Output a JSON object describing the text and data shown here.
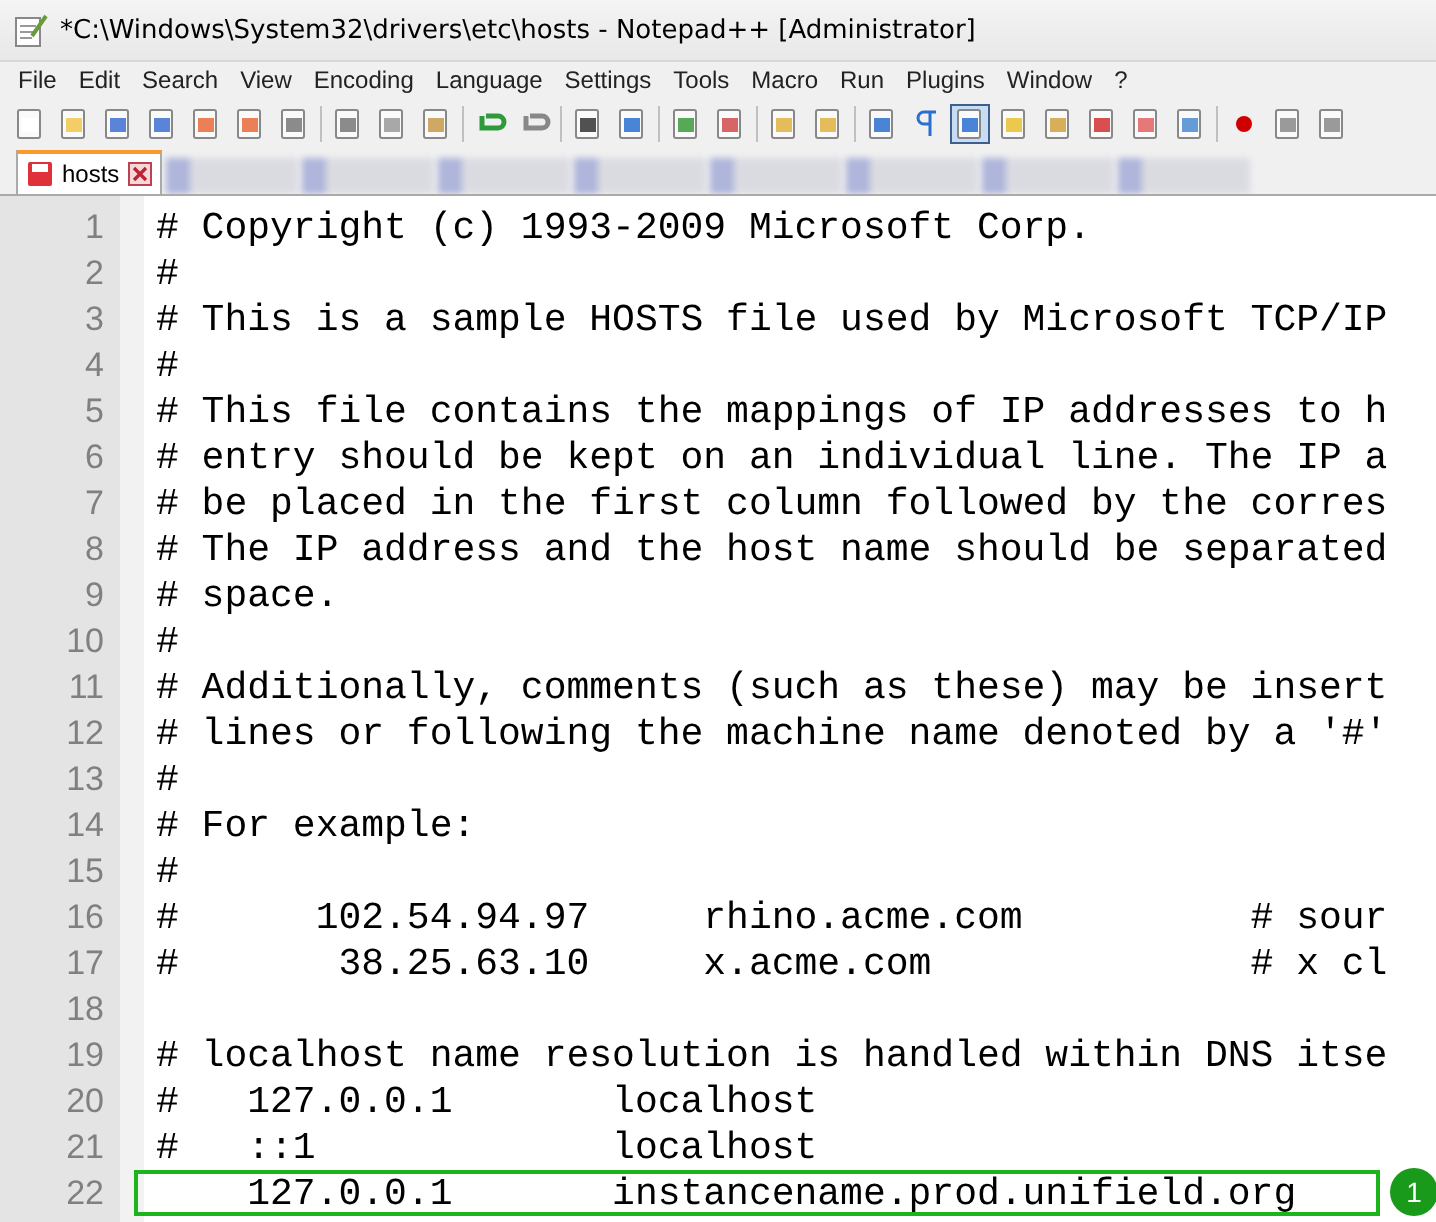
{
  "window": {
    "title": "*C:\\Windows\\System32\\drivers\\etc\\hosts - Notepad++ [Administrator]"
  },
  "menu": [
    "File",
    "Edit",
    "Search",
    "View",
    "Encoding",
    "Language",
    "Settings",
    "Tools",
    "Macro",
    "Run",
    "Plugins",
    "Window",
    "?"
  ],
  "tabs": [
    {
      "label": "hosts",
      "selected": true,
      "modified": true
    }
  ],
  "editor": {
    "lines": [
      {
        "number": "1",
        "text": "# Copyright (c) 1993-2009 Microsoft Corp.",
        "highlighted": false
      },
      {
        "number": "2",
        "text": "#",
        "highlighted": false
      },
      {
        "number": "3",
        "text": "# This is a sample HOSTS file used by Microsoft TCP/IP",
        "highlighted": false
      },
      {
        "number": "4",
        "text": "#",
        "highlighted": false
      },
      {
        "number": "5",
        "text": "# This file contains the mappings of IP addresses to h",
        "highlighted": false
      },
      {
        "number": "6",
        "text": "# entry should be kept on an individual line. The IP a",
        "highlighted": false
      },
      {
        "number": "7",
        "text": "# be placed in the first column followed by the corres",
        "highlighted": false
      },
      {
        "number": "8",
        "text": "# The IP address and the host name should be separated",
        "highlighted": false
      },
      {
        "number": "9",
        "text": "# space.",
        "highlighted": false
      },
      {
        "number": "10",
        "text": "#",
        "highlighted": false
      },
      {
        "number": "11",
        "text": "# Additionally, comments (such as these) may be insert",
        "highlighted": false
      },
      {
        "number": "12",
        "text": "# lines or following the machine name denoted by a '#'",
        "highlighted": false
      },
      {
        "number": "13",
        "text": "#",
        "highlighted": false
      },
      {
        "number": "14",
        "text": "# For example:",
        "highlighted": false
      },
      {
        "number": "15",
        "text": "#",
        "highlighted": false
      },
      {
        "number": "16",
        "text": "#      102.54.94.97     rhino.acme.com          # sour",
        "highlighted": false
      },
      {
        "number": "17",
        "text": "#       38.25.63.10     x.acme.com              # x cl",
        "highlighted": false
      },
      {
        "number": "18",
        "highlighted": false
      },
      {
        "number": "19",
        "text": "# localhost name resolution is handled within DNS itse",
        "highlighted": false
      },
      {
        "number": "20",
        "text": "#   127.0.0.1       localhost",
        "highlighted": false
      },
      {
        "number": "21",
        "text": "#   ::1             localhost",
        "highlighted": false
      },
      {
        "number": "22",
        "text": "    127.0.0.1       instancename.prod.unifield.org",
        "highlighted": true,
        "badge": "1"
      }
    ]
  }
}
